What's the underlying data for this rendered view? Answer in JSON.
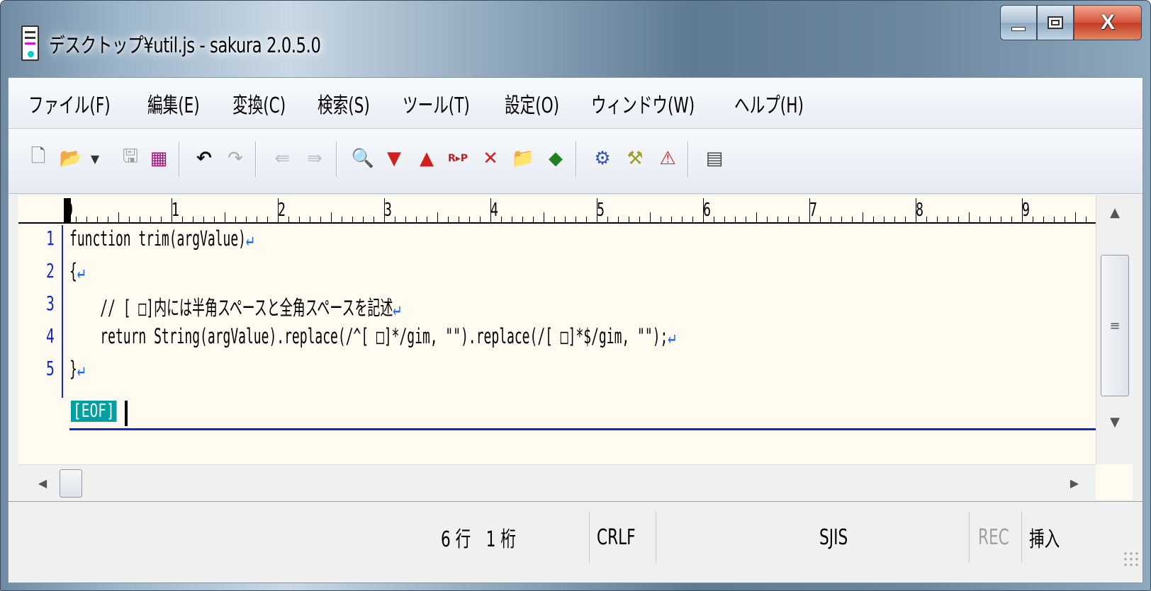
{
  "window": {
    "title": "デスクトップ¥util.js - sakura 2.0.5.0",
    "close_label": "X"
  },
  "menu": [
    "ファイル(F)",
    "編集(E)",
    "変換(C)",
    "検索(S)",
    "ツール(T)",
    "設定(O)",
    "ウィンドウ(W)",
    "ヘルプ(H)"
  ],
  "toolbar_icons": [
    "new-file-icon",
    "open-file-icon",
    "dropdown-arrow-icon",
    "save-icon",
    "save-all-icon",
    "undo-icon",
    "redo-icon",
    "jump-back-icon",
    "jump-forward-icon",
    "search-icon",
    "search-next-icon",
    "search-prev-icon",
    "replace-icon",
    "clear-highlight-icon",
    "grep-icon",
    "outline-icon",
    "compile-icon",
    "run-icon",
    "debug-icon",
    "window-list-icon"
  ],
  "ruler": [
    "0",
    "1",
    "2",
    "3",
    "4",
    "5",
    "6",
    "7",
    "8",
    "9"
  ],
  "editor": {
    "lines": [
      {
        "no": "1",
        "text": "function trim(argValue)"
      },
      {
        "no": "2",
        "text": "{"
      },
      {
        "no": "3",
        "text": "    // [ □]内には半角スペースと全角スペースを記述"
      },
      {
        "no": "4",
        "text": "    return String(argValue).replace(/^[ □]*/gim, \"\").replace(/[ □]*$/gim, \"\");"
      },
      {
        "no": "5",
        "text": "}"
      }
    ],
    "return_mark": "↵",
    "eof": "[EOF]"
  },
  "status": {
    "position": "6 行　1 桁",
    "line_ending": "CRLF",
    "encoding": "SJIS",
    "rec": "REC",
    "mode": "挿入"
  }
}
